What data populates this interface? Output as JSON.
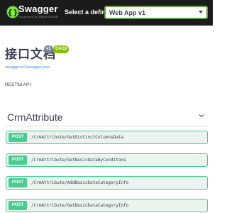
{
  "header": {
    "logo_title": "Swagger",
    "logo_sub": "Supported by SMARTBEAR",
    "definition_label": "Select a definition",
    "definition_value": "Web App v1"
  },
  "info": {
    "title": "接口文档",
    "version_badge": "v1",
    "oas_badge": "OAS3",
    "url": "/swagger/v1/swagger.json",
    "description": "RESTful API"
  },
  "tag": {
    "name": "CrmAttribute"
  },
  "operations": [
    {
      "method": "POST",
      "path": "/CrmAttribute/GetDistinctColumnsData"
    },
    {
      "method": "POST",
      "path": "/CrmAttribute/GetBasicDataByConditons"
    },
    {
      "method": "POST",
      "path": "/CrmAttribute/AddBasicDataCategoryInfo"
    },
    {
      "method": "POST",
      "path": "/CrmAttribute/GetBasicDataCategoryInfo"
    }
  ],
  "colors": {
    "topbar": "#1b1b1b",
    "accent": "#62a03f",
    "post": "#49cc90",
    "post_bg": "#eaf4ee",
    "link": "#4990e2"
  },
  "icons": {
    "logo": "swagger-logo-icon",
    "select_arrow": "chevron-down-icon",
    "tag_toggle": "chevron-down-icon"
  }
}
